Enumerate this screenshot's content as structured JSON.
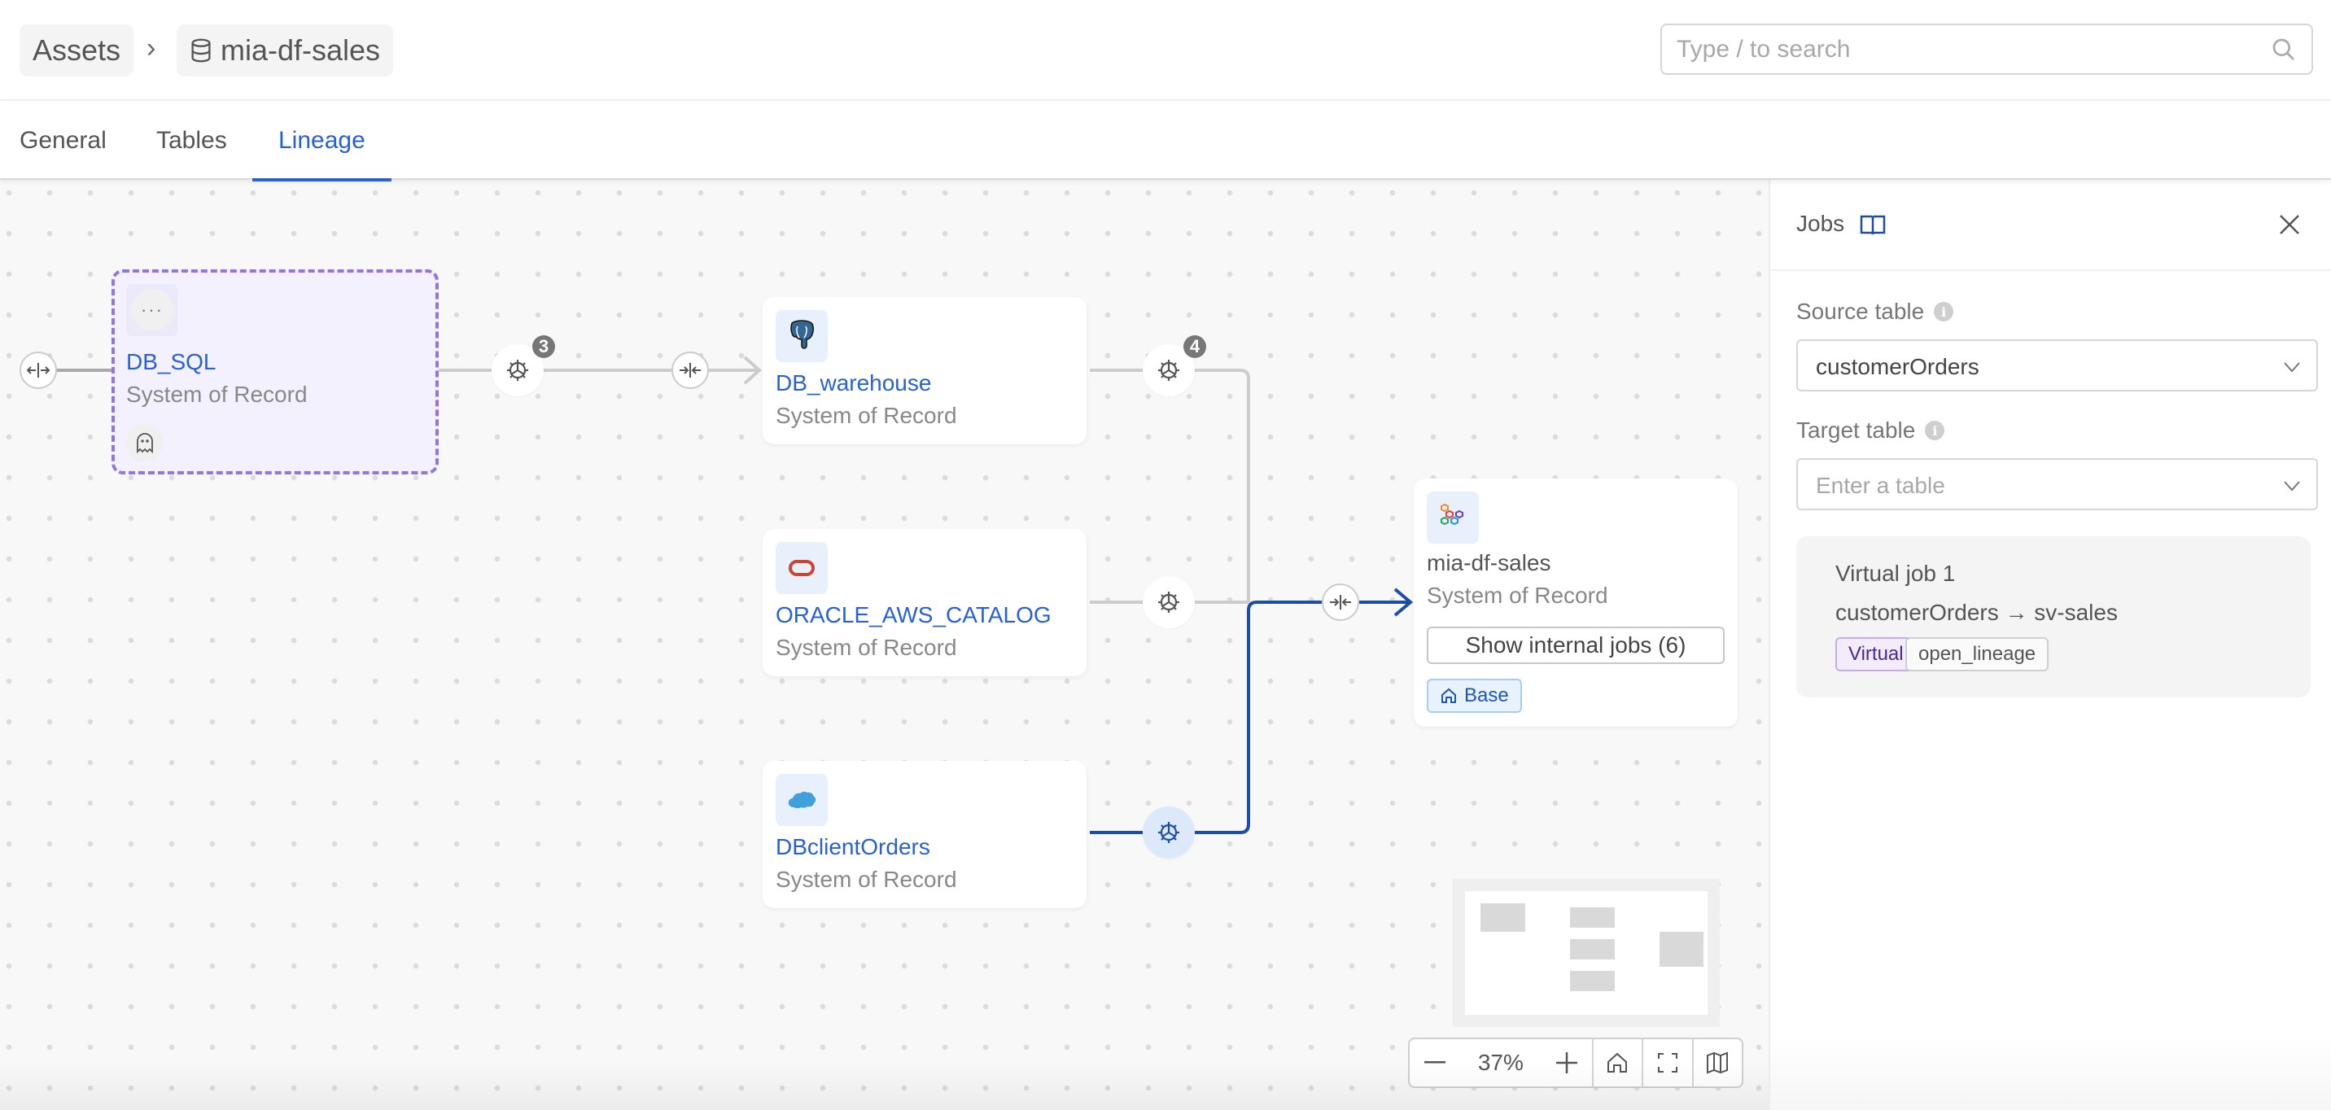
{
  "breadcrumb": {
    "root": "Assets",
    "separator": "›",
    "current": "mia-df-sales",
    "current_icon": "database-icon"
  },
  "search": {
    "placeholder": "Type / to search",
    "value": ""
  },
  "tabs": [
    {
      "label": "General",
      "active": false
    },
    {
      "label": "Tables",
      "active": false
    },
    {
      "label": "Lineage",
      "active": true
    }
  ],
  "lineage": {
    "nodes": [
      {
        "id": "db_sql",
        "title": "DB_SQL",
        "subtitle": "System of Record",
        "icon": "more-icon",
        "selected": true,
        "extra_icon": "ghost-icon"
      },
      {
        "id": "db_warehouse",
        "title": "DB_warehouse",
        "subtitle": "System of Record",
        "icon": "postgresql-icon"
      },
      {
        "id": "oracle",
        "title": "ORACLE_AWS_CATALOG",
        "subtitle": "System of Record",
        "icon": "oracle-icon"
      },
      {
        "id": "dbclientorders",
        "title": "DBclientOrders",
        "subtitle": "System of Record",
        "icon": "salesforce-icon"
      },
      {
        "id": "mia_df_sales",
        "title": "mia-df-sales",
        "subtitle": "System of Record",
        "icon": "dataflow-icon",
        "button": "Show internal jobs (6)",
        "tag": "Base"
      }
    ],
    "job_nodes": [
      {
        "id": "job-dbsql-warehouse",
        "count": "3",
        "active": false
      },
      {
        "id": "job-warehouse-target",
        "count": "4",
        "active": false
      },
      {
        "id": "job-oracle-target",
        "count": null,
        "active": false
      },
      {
        "id": "job-clientorders-target",
        "count": null,
        "active": true
      }
    ],
    "colors": {
      "edge": "#cccccc",
      "edge_active": "#1a4ea8",
      "selected_border": "#9373e6",
      "link": "#2860d8"
    }
  },
  "zoom_controls": {
    "zoom_out": "−",
    "level": "37%",
    "zoom_in": "+"
  },
  "panel": {
    "title": "Jobs",
    "source_label": "Source table",
    "source_value": "customerOrders",
    "target_label": "Target table",
    "target_placeholder": "Enter a table",
    "info": "i",
    "jobs": [
      {
        "name": "Virtual job 1",
        "path": "customerOrders → sv-sales",
        "tags": [
          "Virtual",
          "open_lineage"
        ]
      }
    ]
  }
}
